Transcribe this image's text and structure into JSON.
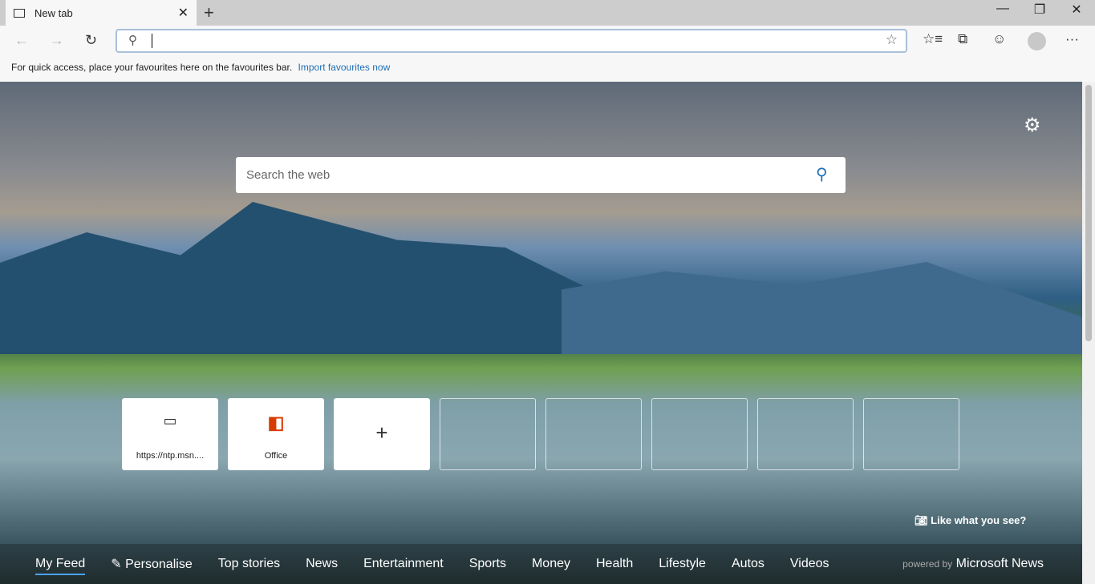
{
  "tab": {
    "title": "New tab"
  },
  "address": {
    "value": ""
  },
  "favbar": {
    "text": "For quick access, place your favourites here on the favourites bar.",
    "link": "Import favourites now"
  },
  "search": {
    "placeholder": "Search the web"
  },
  "tiles": [
    {
      "label": "https://ntp.msn...."
    },
    {
      "label": "Office"
    }
  ],
  "like": "Like what you see?",
  "feed": {
    "items": [
      "My Feed",
      "Personalise",
      "Top stories",
      "News",
      "Entertainment",
      "Sports",
      "Money",
      "Health",
      "Lifestyle",
      "Autos",
      "Videos"
    ],
    "powered_by": "powered by",
    "brand": "Microsoft News"
  },
  "colors": {
    "accent": "#1f6fb5",
    "office": "#d83b01"
  }
}
